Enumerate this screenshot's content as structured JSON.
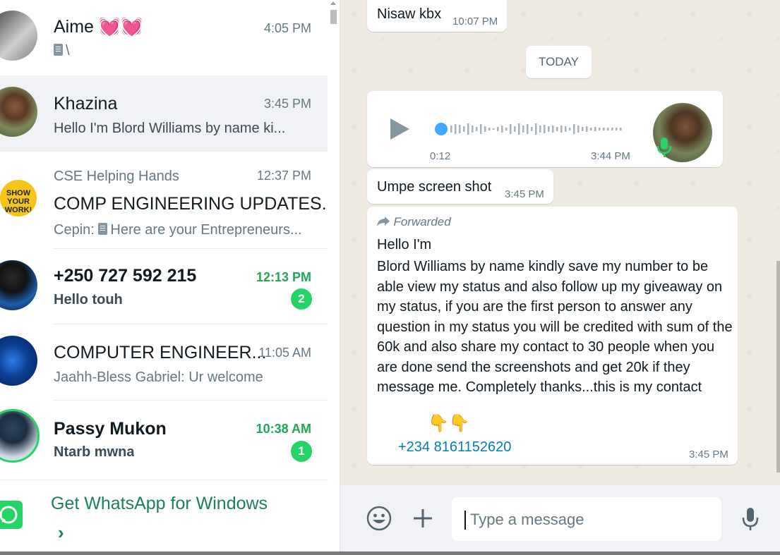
{
  "chat_list": [
    {
      "name": "Aime 💓💓",
      "time": "4:05 PM",
      "preview": "\\",
      "has_doc_icon": true
    },
    {
      "name": "Khazina",
      "time": "3:45 PM",
      "preview": "Hello I'm  Blord Williams by name ki..."
    },
    {
      "community": "CSE Helping Hands",
      "name": "COMP ENGINEERING UPDATES.",
      "time": "12:37 PM",
      "preview_sender": "Cepin:",
      "preview": "Here are your Entrepreneurs..."
    },
    {
      "name": "+250 727 592 215",
      "time": "12:13 PM",
      "preview": "Hello touh",
      "unread": "2"
    },
    {
      "name": "COMPUTER ENGINEER...",
      "time": "11:05 AM",
      "preview": "Jaahh-Bless Gabriel: Ur welcome"
    },
    {
      "name": "Passy Mukon",
      "time": "10:38 AM",
      "preview": "Ntarb mwna",
      "unread": "1"
    }
  ],
  "get_whatsapp": {
    "label": "Get WhatsApp for Windows",
    "chevron": "›"
  },
  "conversation": {
    "msg_top": {
      "text": "Nisaw kbx",
      "time": "10:07 PM"
    },
    "day_chip": "TODAY",
    "voice": {
      "duration": "0:12",
      "time": "3:44 PM"
    },
    "msg_screenshot": {
      "text": "Umpe screen shot",
      "time": "3:45 PM"
    },
    "forwarded": {
      "label": "Forwarded",
      "line1": "Hello I'm",
      "body": "Blord Williams by name kindly save my number to be able view my status and also follow up my giveaway on my status, if you are the first person to answer any question in my status you will be credited with sum of the 60k and also share my contact to 30 people when you are done send the screenshots and get 20k if they message me. Completely thanks...this is my contact",
      "emoji": "👇👇",
      "phone": "+234 8161152620",
      "time": "3:45 PM"
    }
  },
  "composer": {
    "placeholder": "Type a message"
  },
  "icons": [
    "emoji-icon",
    "plus-icon",
    "mic-icon",
    "play-icon",
    "forward-icon",
    "doc-icon",
    "whatsapp-logo-icon"
  ],
  "colors": {
    "green": "#1fa855",
    "badge": "#25d366",
    "link": "#027eb5",
    "wallpaper": "#efeae2",
    "panel": "#f0f2f5"
  }
}
